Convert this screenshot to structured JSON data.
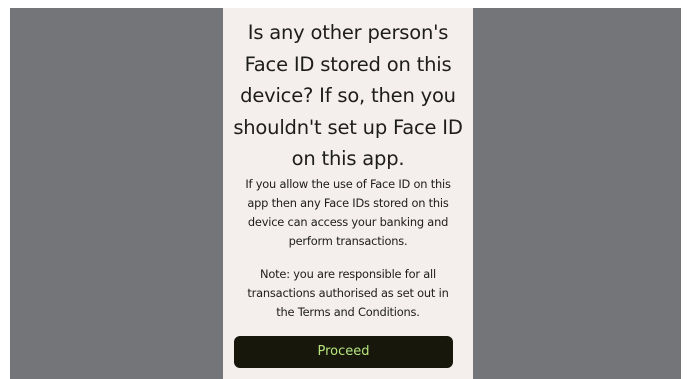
{
  "dialog": {
    "heading_lines": [
      "Is any other person's",
      "Face ID stored on this",
      "device? If so, then you",
      "shouldn't set up Face ID",
      "on this app."
    ],
    "paragraph_1_lines": [
      "If you allow the use of Face ID on this",
      "app then any Face IDs stored on this",
      "device can access your banking and",
      "perform transactions."
    ],
    "paragraph_2_lines": [
      "Note: you are responsible for all",
      "transactions authorised as set out in",
      "the Terms and Conditions."
    ],
    "proceed_label": "Proceed"
  },
  "colors": {
    "backdrop": "#737578",
    "panel": "#f4eeed",
    "text": "#1d1d1b",
    "button_bg": "#17180b",
    "button_text": "#b6e57c"
  }
}
